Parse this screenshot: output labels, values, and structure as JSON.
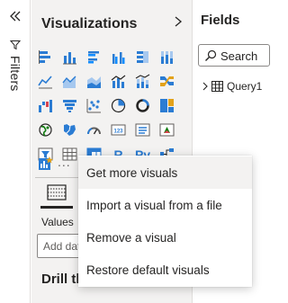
{
  "filters": {
    "label": "Filters"
  },
  "visualizations": {
    "title": "Visualizations",
    "icons": [
      "stacked-bar-chart-icon",
      "stacked-column-chart-icon",
      "clustered-bar-chart-icon",
      "clustered-column-chart-icon",
      "100-stacked-bar-chart-icon",
      "100-stacked-column-chart-icon",
      "line-chart-icon",
      "area-chart-icon",
      "stacked-area-chart-icon",
      "line-and-column-chart-icon",
      "line-and-stacked-column-chart-icon",
      "ribbon-chart-icon",
      "waterfall-chart-icon",
      "funnel-chart-icon",
      "scatter-chart-icon",
      "pie-chart-icon",
      "donut-chart-icon",
      "treemap-icon",
      "map-icon",
      "filled-map-icon",
      "gauge-icon",
      "card-icon",
      "multi-row-card-icon",
      "kpi-icon",
      "slicer-icon",
      "table-icon",
      "matrix-icon",
      "r-script-visual-icon",
      "python-visual-icon",
      "key-influencers-icon"
    ],
    "r_text": "R",
    "py_text": "Py",
    "more": "...",
    "values_label": "Values",
    "add_data_text": "Add data fields here",
    "drill_title": "Drill through"
  },
  "fields": {
    "title": "Fields",
    "search_placeholder": "Search",
    "table_name": "Query1"
  },
  "context_menu": {
    "items": [
      "Get more visuals",
      "Import a visual from a file",
      "Remove a visual",
      "Restore default visuals"
    ]
  },
  "colors": {
    "accent": "#2b7cd3",
    "teal": "#118dff",
    "pane_bg": "#f3f2f1"
  }
}
